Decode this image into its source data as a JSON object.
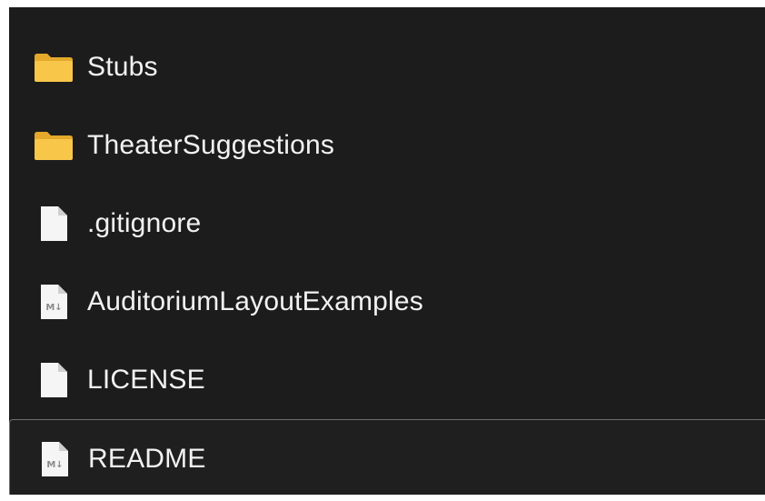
{
  "file_list": {
    "items": [
      {
        "name": "Stubs",
        "type": "folder",
        "icon": "folder-icon"
      },
      {
        "name": "TheaterSuggestions",
        "type": "folder",
        "icon": "folder-icon"
      },
      {
        "name": ".gitignore",
        "type": "file",
        "icon": "file-icon"
      },
      {
        "name": "AuditoriumLayoutExamples",
        "type": "markdown",
        "icon": "markdown-file-icon",
        "badge": "M↓"
      },
      {
        "name": "LICENSE",
        "type": "file",
        "icon": "file-icon"
      },
      {
        "name": "README",
        "type": "markdown",
        "icon": "markdown-file-icon",
        "badge": "M↓"
      }
    ]
  },
  "colors": {
    "background": "#1c1c1c",
    "text": "#f2f2f2",
    "folder_front": "#f8c74a",
    "folder_back": "#e4a92a",
    "file": "#f5f5f5",
    "focus_border": "#6e6e6e"
  }
}
